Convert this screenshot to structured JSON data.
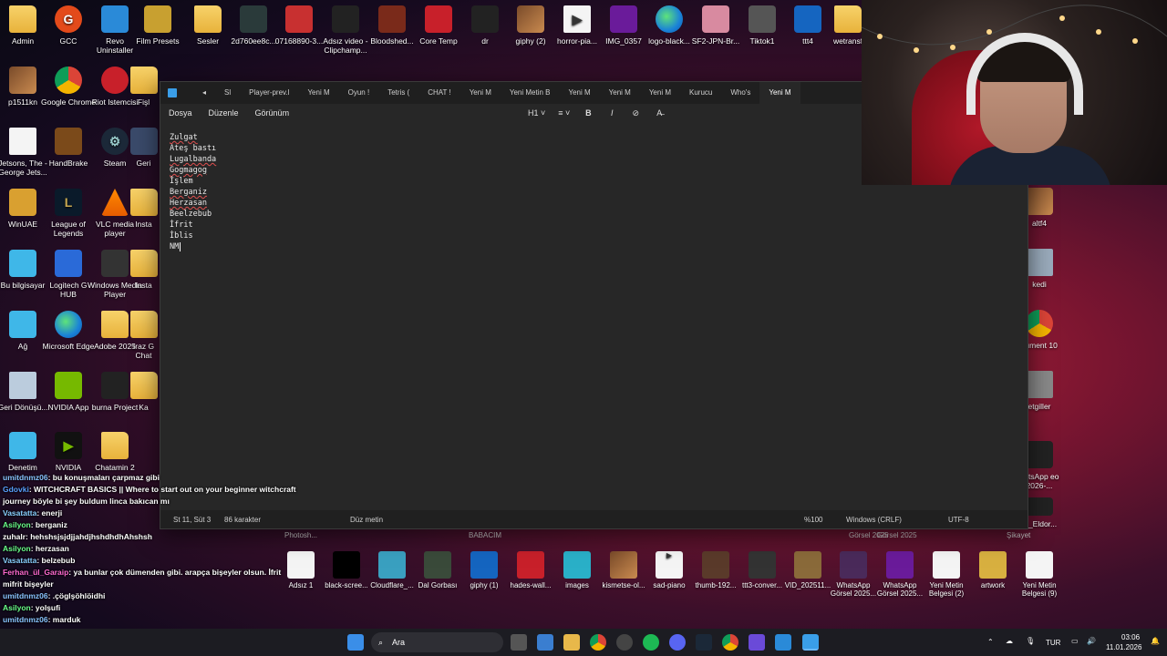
{
  "desktop": {
    "icons_col1": [
      "Admin",
      "p1511kn",
      "Jetsons, The - George Jets...",
      "WinUAE",
      "Bu bilgisayar",
      "Ağ",
      "Geri Dönüşü...",
      "Denetim"
    ],
    "icons_col2": [
      "GCC",
      "Google Chrome",
      "HandBrake",
      "League of Legends",
      "Logitech G HUB",
      "Microsoft Edge",
      "NVIDIA App",
      "NVIDIA"
    ],
    "icons_col3": [
      "Revo Uninstaller",
      "Riot Istemcisi",
      "Steam",
      "VLC media player",
      "Windows Media Player",
      "Adobe 2025",
      "burna Project",
      "Chatamin 2"
    ],
    "icons_col4": [
      "Film Presets",
      "Fişl",
      "Geri",
      "Insta",
      "Insta",
      "Iraz G Chat",
      "Ka",
      ""
    ],
    "top_row": [
      "Sesler",
      "2d760ee8c...",
      "07168890-3...",
      "Adsız video - Clipchamp...",
      "Bloodshed...",
      "Core Temp",
      "dr",
      "giphy (2)",
      "horror-pia...",
      "IMG_0357",
      "logo-black...",
      "SF2-JPN-Br...",
      "Tiktok1",
      "ttt4",
      "wetransf"
    ],
    "right_col": [
      "altf4",
      "kedi",
      "cument 10",
      "etgiller",
      "hatsApp eo 2026-...",
      "m_Eldor..."
    ],
    "bottom_row": [
      "Photosh...",
      "Adsız 1",
      "black-scree...",
      "Cloudflare_...",
      "Dal Gorbası",
      "giphy (1)",
      "hades-wall...",
      "images",
      "kismetse-ol...",
      "sad-piano",
      "thumb-192...",
      "ttt3-conver...",
      "VID_202511...",
      "WhatsApp Görsel 2025...",
      "WhatsApp Görsel 2025...",
      "Yeni Metin Belgesi (2)",
      "artwork",
      "Yeni Metin Belgesi (9)"
    ],
    "bottom_row_top_labels": [
      "BABACIM",
      "Görsel 2025",
      "Görsel 2025",
      "Şikayet"
    ]
  },
  "notepad": {
    "tabs": [
      "Sl",
      "Player-prev.l",
      "Yeni M",
      "Oyun !",
      "Tetris (",
      "CHAT !",
      "Yeni M",
      "Yeni Metin B",
      "Yeni M",
      "Yeni M",
      "Yeni M",
      "Kurucu",
      "Who's",
      "Yeni M"
    ],
    "menu": {
      "file": "Dosya",
      "edit": "Düzenle",
      "view": "Görünüm"
    },
    "format": {
      "heading": "H1",
      "list": "≡",
      "bold": "B",
      "italic": "I",
      "link": "⊘",
      "clear": "A̶"
    },
    "lines": [
      "Zulgat",
      "Ateş bastı",
      "Lugalbanda",
      "Gogmagog",
      "İşlem",
      "Berganiz",
      "Herzasan",
      "Beelzebub",
      "İfrit",
      "İblis",
      "NM"
    ],
    "status": {
      "position": "St 11, Süt 3",
      "chars": "86 karakter",
      "format": "Düz metin",
      "zoom": "%100",
      "eol": "Windows (CRLF)",
      "encoding": "UTF-8"
    }
  },
  "chat": [
    {
      "user": "umitdnmz06",
      "msg": "bu konuşmaları çarpmaz gibi",
      "color": "#8ac4ff"
    },
    {
      "user": "Gdovki",
      "msg": "WITCHCRAFT BASICS || Where to start out on your beginner witchcraft",
      "color": "#5aa0ff"
    },
    {
      "user": "",
      "msg": "journey böyle bi şey buldum linca bakıcan mı",
      "color": "#ffffff"
    },
    {
      "user": "Vasatatta",
      "msg": "enerji",
      "color": "#8ad0ff"
    },
    {
      "user": "Asilyon",
      "msg": "berganiz",
      "color": "#6aff8a"
    },
    {
      "user": "zuhalr",
      "msg": "hehshsjsjdjjahdjhshdhdhAhshsh",
      "color": "#ffffff"
    },
    {
      "user": "Asilyon",
      "msg": "herzasan",
      "color": "#6aff8a"
    },
    {
      "user": "Vasatatta",
      "msg": "belzebub",
      "color": "#8ad0ff"
    },
    {
      "user": "Ferhan_ül_Garaip",
      "msg": "ya bunlar çok dümenden gibi. arapça bişeyler olsun. İfrit",
      "color": "#ff6ad0"
    },
    {
      "user": "",
      "msg": "mifrit bişeyler",
      "color": "#ffffff"
    },
    {
      "user": "umitdnmz06",
      "msg": ".çöglşöhlöidhi",
      "color": "#8ac4ff"
    },
    {
      "user": "Asilyon",
      "msg": "yolşufi",
      "color": "#6aff8a"
    },
    {
      "user": "umitdnmz06",
      "msg": "marduk",
      "color": "#8ac4ff"
    }
  ],
  "taskbar": {
    "search_placeholder": "Ara",
    "lang": "TUR",
    "time": "03:06",
    "date": "11.01.2026"
  }
}
